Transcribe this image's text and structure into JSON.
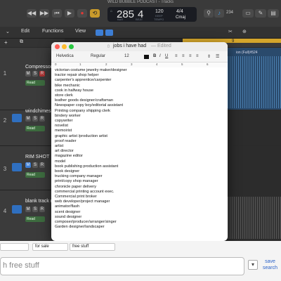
{
  "logic": {
    "window_title": "WILD BUBBLE PODCAST - Tracks",
    "lcd": {
      "bar": "285",
      "beat": "4",
      "bar_label": "BAR",
      "beat_label": "BEAT",
      "tempo": "120",
      "tempo_label": "KEEP",
      "tempo_sub": "TEMPO",
      "signature": "4/4",
      "key": "Cmaj"
    },
    "counter": "234",
    "menus": [
      "Edit",
      "Functions",
      "View"
    ],
    "tracks": [
      {
        "num": "1",
        "name": "Compressor",
        "read": "Read"
      },
      {
        "num": "2",
        "name": "windchimes",
        "read": "Read"
      },
      {
        "num": "3",
        "name": "RIM SHOT",
        "read": "Read"
      },
      {
        "num": "4",
        "name": "blank track n",
        "read": "Read"
      }
    ],
    "region_label": "ion (Full)#524",
    "ruler_mark": "9"
  },
  "textedit": {
    "title": "jobs i have had",
    "edited": "— Edited",
    "font": "Helvetica",
    "style": "Regular",
    "size": "12",
    "ruler_ticks": [
      "0",
      "1",
      "2",
      "3",
      "4",
      "5",
      "6"
    ],
    "lines": [
      "victorian costume jewelry maker/designer",
      "tractor repair shop helper",
      "carpenter's apprentice/carpenter",
      "bike mechanic",
      "cook in halfway house",
      "store clerk",
      "leather goods designer/craftsman",
      "Newspaper copy boy/editorial assistant",
      "Printing company shipping clerk",
      "bindery worker",
      "copywriter",
      "novelist",
      "memoirist",
      "graphic artist /production artist",
      "proof reader",
      "artist",
      "art director",
      "magazine editor",
      "model",
      "book publishing production assistant",
      "book designer",
      "trucking company manager",
      "print/copy shop manager",
      "chronicle paper delivery",
      "commercial printing account exec.",
      "Commercial print broker",
      "web developer/project manager",
      "animator/flash",
      "scent designer",
      "sound designer",
      "composer/producer/arranger/singer",
      "Garden designer/landscaper"
    ]
  },
  "browser": {
    "filter1": "",
    "filter2": "for sale",
    "filter3": "free stuff",
    "search_text": "h free stuff",
    "save_search": "save search"
  }
}
